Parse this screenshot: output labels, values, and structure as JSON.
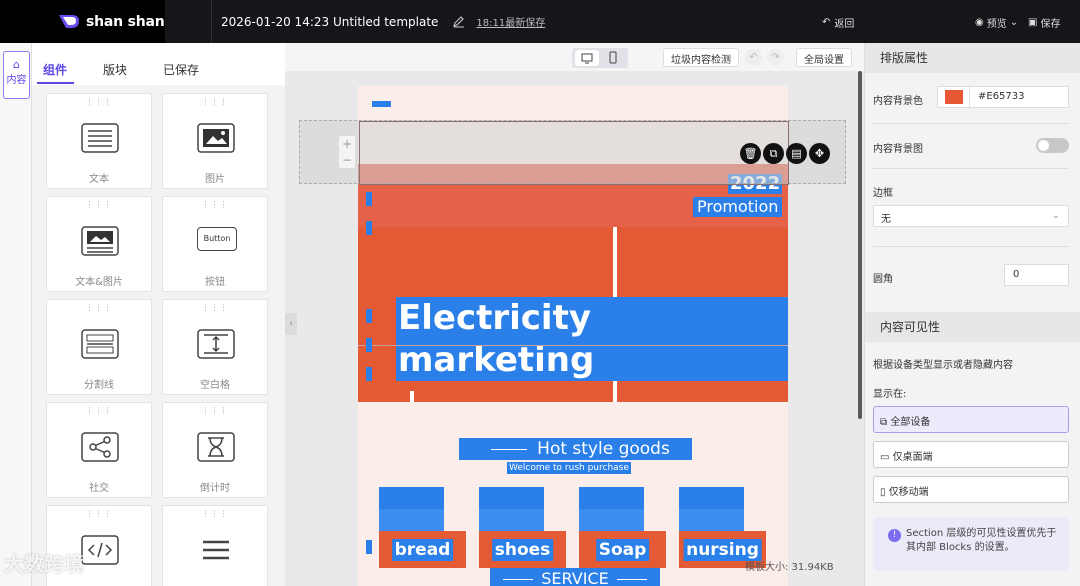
{
  "topbar": {
    "brand": "shan shan",
    "doc_title": "2026-01-20 14:23 Untitled template",
    "saved_text": "18:11最新保存",
    "back_label": "返回",
    "preview_label": "预览",
    "save_label": "保存"
  },
  "left_rail": {
    "content_tab": "内容"
  },
  "component_panel": {
    "tabs": [
      "组件",
      "版块",
      "已保存"
    ],
    "cards": [
      "文本",
      "图片",
      "文本&图片",
      "按钮",
      "分割线",
      "空白格",
      "社交",
      "倒计时",
      "",
      ""
    ],
    "button_icon_text": "Button"
  },
  "canvas_toolbar": {
    "spam_check": "垃圾内容检测",
    "global_settings": "全局设置"
  },
  "page": {
    "promo_year": "2022",
    "promo_word": "Promotion",
    "headline": "Electricity marketing",
    "section_title": "Hot style goods",
    "section_subtitle": "Welcome to rush purchase",
    "products": [
      "bread",
      "shoes",
      "Soap",
      "nursing"
    ],
    "service_title": "SERVICE",
    "template_size": "模板大小: 31.94KB"
  },
  "properties": {
    "layout_header": "排版属性",
    "bg_color_label": "内容背景色",
    "bg_color_value": "#E65733",
    "bg_image_label": "内容背景图",
    "bg_image_enabled": false,
    "border_label": "边框",
    "border_value": "无",
    "radius_label": "圆角",
    "radius_value": "0",
    "visibility_header": "内容可见性",
    "visibility_desc": "根据设备类型显示或者隐藏内容",
    "show_on_label": "显示在:",
    "visibility_options": [
      "全部设备",
      "仅桌面端",
      "仅移动端"
    ],
    "visibility_selected": "全部设备",
    "note_line1": "Section 层级的可见性设置优先于",
    "note_line2": "其内部 Blocks 的设置。"
  },
  "watermark": "大数跨境",
  "colors": {
    "accent": "#5b46e6",
    "hero": "#E65733",
    "highlight": "#2a7fe8"
  }
}
